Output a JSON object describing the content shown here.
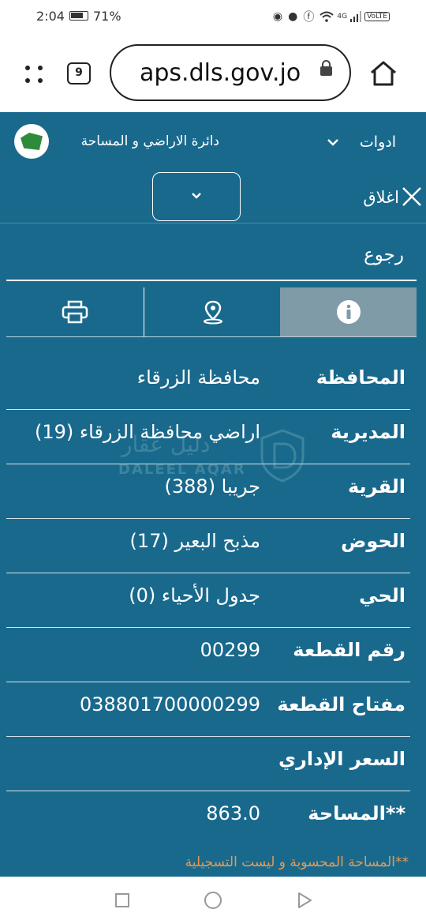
{
  "status_bar": {
    "time": "2:04",
    "battery": "71%",
    "network": "4G",
    "volte": "VoLTE"
  },
  "browser": {
    "tab_count": "9",
    "url": "aps.dls.gov.jo"
  },
  "site": {
    "department": "دائرة الاراضي و المساحة",
    "tools_label": "ادوات",
    "close_label": "اغلاق",
    "back_label": "رجوع"
  },
  "parcel": {
    "rows": [
      {
        "label": "المحافظة",
        "value": "محافظة الزرقاء"
      },
      {
        "label": "المديرية",
        "value": "اراضي محافظة الزرقاء (19)"
      },
      {
        "label": "القرية",
        "value": "جريبا (388)"
      },
      {
        "label": "الحوض",
        "value": "مذبح البعير (17)"
      },
      {
        "label": "الحي",
        "value": "جدول الأحياء (0)"
      },
      {
        "label": "رقم القطعة",
        "value": "00299"
      },
      {
        "label": "مفتاح القطعة",
        "value": "038801700000299"
      },
      {
        "label": "السعر الإداري",
        "value": ""
      },
      {
        "label": "**المساحة",
        "value": "863.0"
      }
    ],
    "footnote": "**المساحة المحسوبة و ليست التسجيلية"
  },
  "watermark": {
    "arabic": "دليل عقار",
    "latin": "DALEEL AQAR"
  },
  "colors": {
    "site_bg": "#19698d",
    "active_tab": "#7f9ba8",
    "footnote": "#e69b52"
  }
}
